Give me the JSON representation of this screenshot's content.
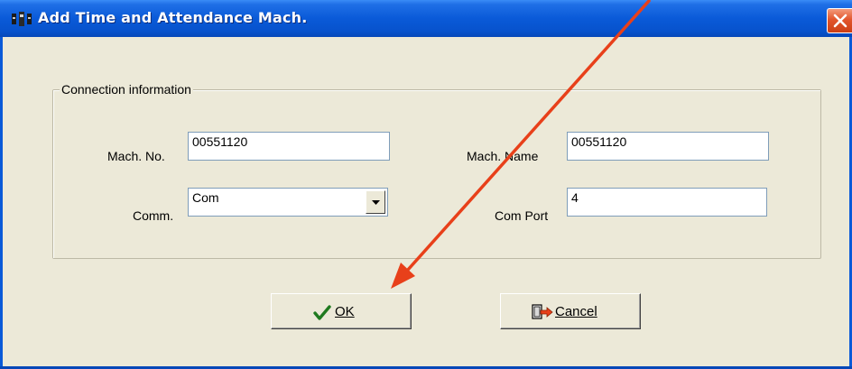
{
  "window": {
    "title": "Add Time and Attendance Mach."
  },
  "connection_group": {
    "legend": "Connection information",
    "mach_no": {
      "label": "Mach. No.",
      "value": "00551120"
    },
    "mach_name": {
      "label": "Mach. Name",
      "value": "00551120"
    },
    "comm": {
      "label": "Comm.",
      "value": "Com"
    },
    "com_port": {
      "label": "Com Port",
      "value": "4"
    }
  },
  "buttons": {
    "ok": {
      "label": "OK",
      "icon": "checkmark-icon"
    },
    "cancel": {
      "label": "Cancel",
      "icon": "exit-door-icon"
    }
  },
  "annotation": {
    "arrow_color": "#e8401a"
  },
  "colors": {
    "titlebar": "#0a5ad8",
    "dialog_bg": "#ece9d8",
    "close_button": "#e2552c"
  }
}
